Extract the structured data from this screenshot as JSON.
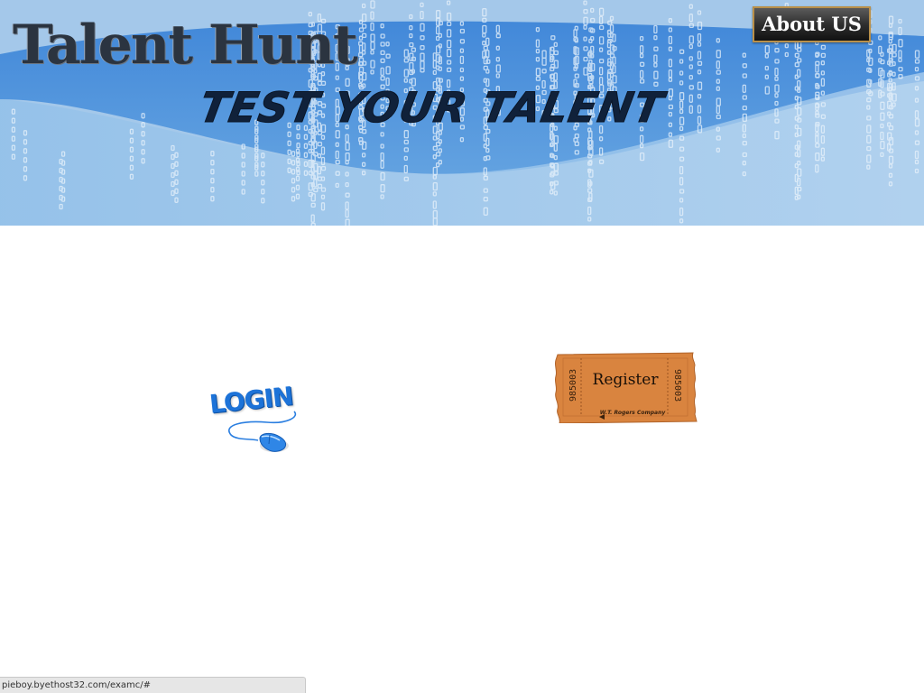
{
  "header": {
    "site_title": "Talent Hunt",
    "tagline": "TEST YOUR TALENT",
    "about_label": "About US",
    "banner_color": "#3f86d6"
  },
  "main": {
    "login_label": "LOGIN",
    "register": {
      "label": "Register",
      "ticket_number": "985003",
      "company": "W.T. Rogers Company",
      "ticket_color": "#d9843f"
    }
  },
  "status_bar": {
    "url": "pieboy.byethost32.com/examc/#"
  }
}
